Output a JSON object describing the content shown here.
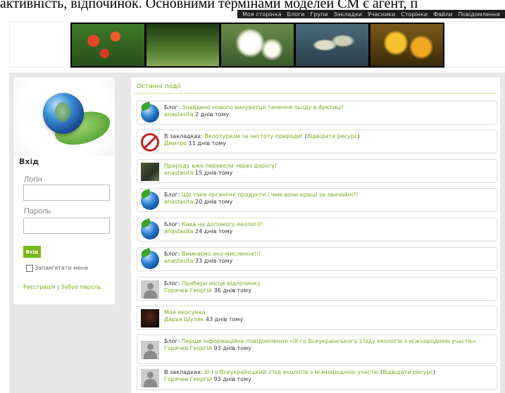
{
  "page": {
    "bg_text": "активність, відпочинок. Основними термінами моделей CM є агент, п"
  },
  "topnav": {
    "items": [
      "Моя сторінка",
      "Блоги",
      "Групи",
      "Закладки",
      "Учасники",
      "Сторінки",
      "Файли",
      "Повідомлення"
    ]
  },
  "login": {
    "title": "Вхід",
    "login_label": "Логін",
    "password_label": "Пароль",
    "submit": "Вхід",
    "remember": "Запам'ятати мене",
    "register": "Реєстрація",
    "separator": "|",
    "forgot": "Забуе пароль"
  },
  "feed": {
    "title": "Останні події",
    "events": [
      {
        "prefix": "Блог: ",
        "title": "Знайдено нового винуватця танення льоду в Арктиці!",
        "extra": "",
        "author": "anastasita",
        "time": " 2 днів тому",
        "avatar": "earth-avatar-icon"
      },
      {
        "prefix": "В закладках: ",
        "title": "Велотуризм за чистоту природи!",
        "extra_open": " (",
        "extra": "Відвідати ресурс",
        "extra_close": ")",
        "author": "Дмитро",
        "time": " 11 днів тому",
        "avatar": "no-bike-avatar-icon"
      },
      {
        "prefix": "",
        "title": "Природу вже перевели через дорогу!",
        "extra": "",
        "author": "anastasita",
        "time": " 15 днів тому",
        "avatar": "photo-avatar-icon"
      },
      {
        "prefix": "Блог: ",
        "title": "Що таке органічні продукти і чим вони кращі за звичайні?!",
        "extra": "",
        "author": "anastasita",
        "time": " 20 днів тому",
        "avatar": "earth-avatar-icon"
      },
      {
        "prefix": "Блог: ",
        "title": "Кава на допомогу екології!",
        "extra": "",
        "author": "anastasita",
        "time": " 24 днів тому",
        "avatar": "earth-avatar-icon"
      },
      {
        "prefix": "Блог: ",
        "title": "Вмикаємо еко-мислення!!!",
        "extra": "",
        "author": "anastasita",
        "time": " 33 днів тому",
        "avatar": "earth-avatar-icon"
      },
      {
        "prefix": "Блог: ",
        "title": "Прибери місце відпочинку",
        "extra": "",
        "author": "Горячев Георгій",
        "time": " 36 днів тому",
        "avatar": "default-user-avatar-icon"
      },
      {
        "prefix": "",
        "title": "Моя екосумка",
        "extra": "",
        "author": "Дарья Шуляк",
        "time": " 43 днів тому",
        "avatar": "dark-photo-avatar-icon"
      },
      {
        "prefix": "Блог: ",
        "title": "Перше інформаційне повідомлення «ІІІ-го Всеукраїнського з'їзду екологів з міжнародною участю»",
        "extra": "",
        "author": "Горячев Георгій",
        "time": " 93 днів тому",
        "avatar": "default-user-avatar-icon"
      },
      {
        "prefix": "В закладках: ",
        "title": "ІІІ-го Всеукраїнський з'їзд екологів з міжнародною участю",
        "extra_open": " (",
        "extra": "Відвідати ресурс",
        "extra_close": ")",
        "author": "Горячев Георгій",
        "time": " 93 днів тому",
        "avatar": "default-user-avatar-icon"
      }
    ]
  },
  "colors": {
    "accent": "#7aaa1c",
    "button": "#7cb518",
    "nav_bg": "#1e1e1e",
    "page_bg": "#e7e7e7"
  }
}
